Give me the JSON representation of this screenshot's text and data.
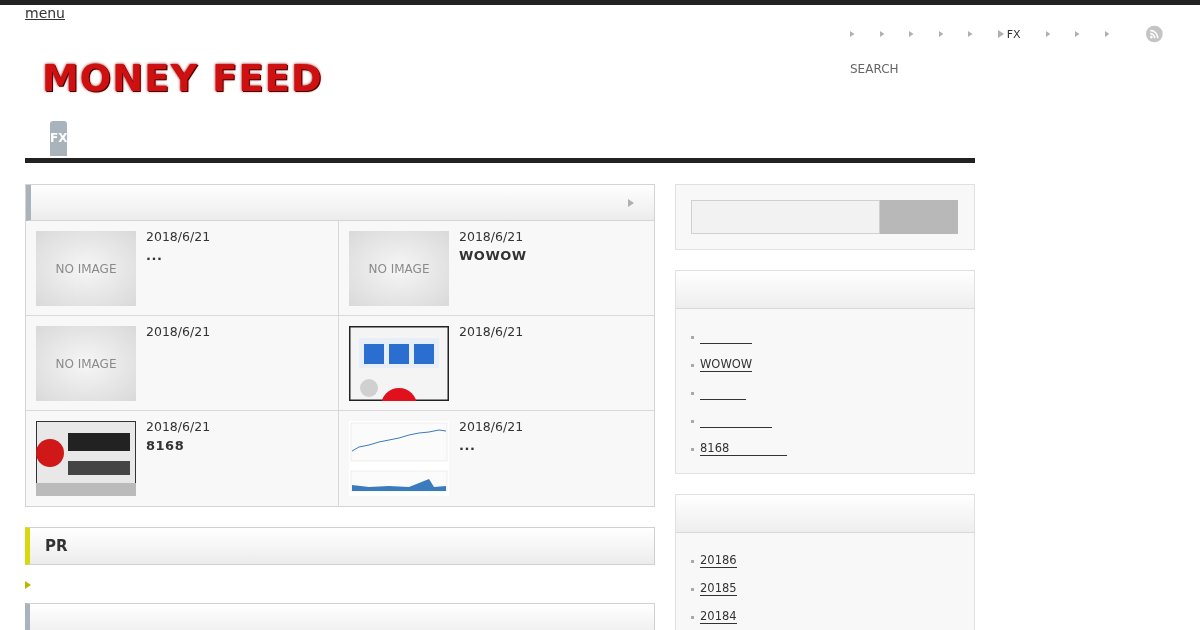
{
  "menu_link": "menu",
  "logo": "MONEY FEED",
  "top_nav": [
    {
      "kind": "bullet"
    },
    {
      "kind": "bullet"
    },
    {
      "kind": "bullet"
    },
    {
      "kind": "bullet"
    },
    {
      "kind": "bullet"
    },
    {
      "kind": "link",
      "label": "FX"
    },
    {
      "kind": "bullet"
    },
    {
      "kind": "bullet"
    },
    {
      "kind": "bullet"
    }
  ],
  "search_label": "SEARCH",
  "tabs": [
    {
      "label": "FX",
      "selected": true
    }
  ],
  "posts": [
    {
      "kind": "placeholder",
      "thumb_text": "NO IMAGE",
      "date": "2018/6/21",
      "title": "..."
    },
    {
      "kind": "placeholder",
      "thumb_text": "NO IMAGE",
      "date": "2018/6/21",
      "title": "WOWOW"
    },
    {
      "kind": "placeholder",
      "thumb_text": "NO IMAGE",
      "date": "2018/6/21"
    },
    {
      "kind": "picture",
      "date": "2018/6/21"
    },
    {
      "kind": "picture",
      "date": "2018/6/21",
      "title": "8168"
    },
    {
      "kind": "picture",
      "date": "2018/6/21",
      "title": "..."
    }
  ],
  "pr_heading": "PR",
  "sidebar_recent": [
    {
      "kind": "blank"
    },
    {
      "kind": "link",
      "label": "WOWOW"
    },
    {
      "kind": "blank"
    },
    {
      "kind": "blank"
    },
    {
      "kind": "link",
      "label": "8168"
    }
  ],
  "sidebar_archive": [
    {
      "label": "20186"
    },
    {
      "label": "20185"
    },
    {
      "label": "20184"
    }
  ]
}
